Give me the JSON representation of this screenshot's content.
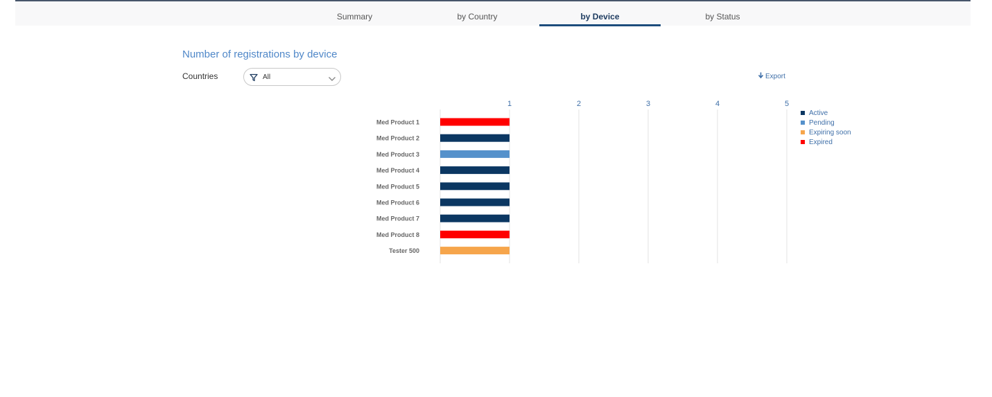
{
  "tabs": [
    {
      "label": "Summary",
      "active": false
    },
    {
      "label": "by Country",
      "active": false
    },
    {
      "label": "by Device",
      "active": true
    },
    {
      "label": "by Status",
      "active": false
    }
  ],
  "page_title": "Number of registrations by device",
  "filter": {
    "label": "Countries",
    "value": "All"
  },
  "export_label": "Export",
  "icons": {
    "filter": "filter-icon",
    "dropdown": "chevron-down-icon",
    "export": "arrow-down-icon"
  },
  "colors": {
    "Active": "#0b3762",
    "Pending": "#5591cb",
    "Expiring soon": "#f6a54b",
    "Expired": "#ff0000"
  },
  "chart_data": {
    "type": "bar",
    "orientation": "horizontal",
    "categories": [
      "Med Product 1",
      "Med Product 2",
      "Med Product 3",
      "Med Product 4",
      "Med Product 5",
      "Med Product 6",
      "Med Product 7",
      "Med Product 8",
      "Tester 500"
    ],
    "values": [
      1,
      1,
      1,
      1,
      1,
      1,
      1,
      1,
      1
    ],
    "status": [
      "Expired",
      "Active",
      "Pending",
      "Active",
      "Active",
      "Active",
      "Active",
      "Expired",
      "Expiring soon"
    ],
    "xticks": [
      "1",
      "2",
      "3",
      "4",
      "5"
    ],
    "xlim": [
      0,
      5
    ],
    "legend": [
      "Active",
      "Pending",
      "Expiring soon",
      "Expired"
    ],
    "legend_position": "right",
    "grid": true
  }
}
